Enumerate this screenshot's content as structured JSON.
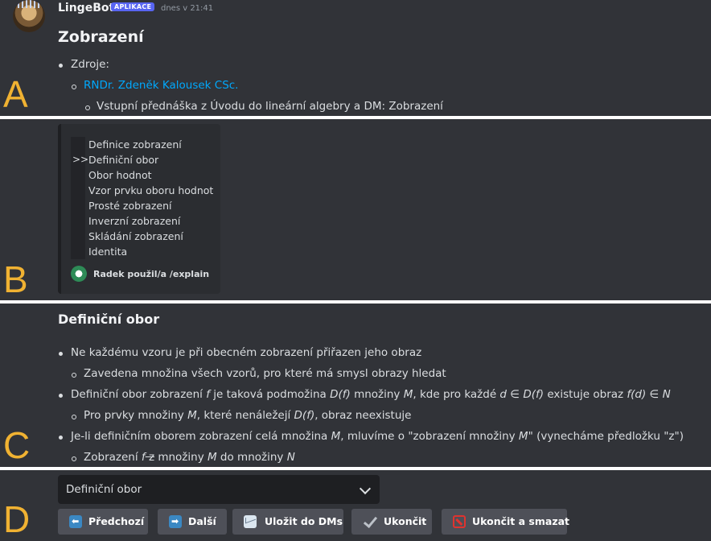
{
  "segments": [
    "A",
    "B",
    "C",
    "D"
  ],
  "header": {
    "username": "LingeBot",
    "badge": "APLIKACE",
    "timestamp": "dnes v 21:41"
  },
  "message": {
    "title": "Zobrazení",
    "sources_label": "Zdroje:",
    "author_link": "RNDr. Zdeněk Kalousek CSc.",
    "source_item": "Vstupní přednáška z Úvodu do lineární algebry a DM: Zobrazení"
  },
  "toc": {
    "marker": ">>",
    "selected_index": 1,
    "items": [
      "Definice zobrazení",
      "Definiční obor",
      "Obor hodnot",
      "Vzor prvku oboru hodnot",
      "Prosté zobrazení",
      "Inverzní zobrazení",
      "Skládání zobrazení",
      "Identita"
    ],
    "footer": "Radek použil/a /explain"
  },
  "section": {
    "title": "Definiční obor",
    "b1": "Ne každému vzoru je při obecném zobrazení přiřazen jeho obraz",
    "b1_sub": "Zavedena množina všech vzorů, pro které má smysl obrazy hledat",
    "b2_a": "Definiční obor zobrazení ",
    "b2_f": "f",
    "b2_b": " je taková podmožina ",
    "b2_df": "D(f)",
    "b2_c": " množiny ",
    "b2_m": "M",
    "b2_d": ", kde pro každé ",
    "b2_d2": "d",
    "b2_e": " ∈ ",
    "b2_df2": "D(f)",
    "b2_f2": " existuje obraz ",
    "b2_fd": "f(d)",
    "b2_g": " ∈ ",
    "b2_n": "N",
    "b2_sub_a": "Pro prvky množiny ",
    "b2_sub_m": "M",
    "b2_sub_b": ", které nenáležejí ",
    "b2_sub_df": "D(f)",
    "b2_sub_c": ", obraz neexistuje",
    "b3_a": "Je-li definičním oborem zobrazení celá množina ",
    "b3_m": "M",
    "b3_b": ", mluvíme o \"zobrazení množiny ",
    "b3_m2": "M",
    "b3_c": "\" (vynecháme předložku \"z\")",
    "b3_sub_a": "Zobrazení ",
    "b3_sub_f": "f",
    "b3_sub_z": " z",
    "b3_sub_b": " množiny ",
    "b3_sub_m": "M",
    "b3_sub_c": " do množiny ",
    "b3_sub_n": "N"
  },
  "controls": {
    "select_value": "Definiční obor",
    "buttons": [
      {
        "label": "Předchozí",
        "icon": "arrow-left-icon"
      },
      {
        "label": "Další",
        "icon": "arrow-right-icon"
      },
      {
        "label": "Uložit do DMs",
        "icon": "envelope-icon"
      },
      {
        "label": "Ukončit",
        "icon": "check-icon"
      },
      {
        "label": "Ukončit a smazat",
        "icon": "no-entry-icon"
      }
    ]
  },
  "colors": {
    "segment_letter": "#f0b232",
    "link": "#00a8fc",
    "badge": "#5865f2",
    "background": "#313338"
  }
}
